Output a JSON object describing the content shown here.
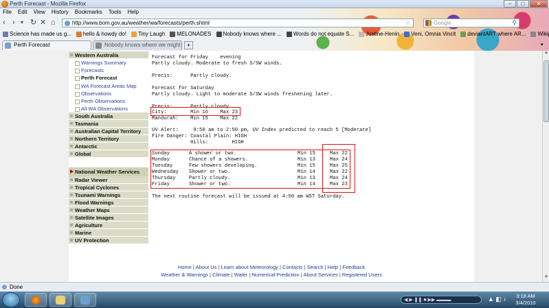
{
  "window": {
    "title": "Perth Forecast - Mozilla Firefox"
  },
  "menu": [
    "File",
    "Edit",
    "View",
    "History",
    "Bookmarks",
    "Tools",
    "Help"
  ],
  "nav": {
    "url": "http://www.bom.gov.au/weather/wa/forecasts/perth.shtml",
    "search_placeholder": "Google"
  },
  "bookmarks": [
    {
      "label": "Science has made us g...",
      "color": "#6b7fb0"
    },
    {
      "label": "hello & howdy do!",
      "color": "#e07b2a"
    },
    {
      "label": "Tiny Laugh",
      "color": "#e8a33a"
    },
    {
      "label": "MELONADES",
      "color": "#555555"
    },
    {
      "label": "Nobody knows where ...",
      "color": "#444444"
    },
    {
      "label": "Words do not equate S...",
      "color": "#444444"
    },
    {
      "label": "Justine-Henin",
      "color": "#bbbbbb"
    },
    {
      "label": "Veni, Omnia Vincit",
      "color": "#3b6fd6"
    },
    {
      "label": "deviantART where AR...",
      "color": "#6aa05a"
    },
    {
      "label": "Wikipedia",
      "color": "#888888"
    }
  ],
  "tabs": [
    {
      "label": "Perth Forecast",
      "active": true
    },
    {
      "label": "Nobody knows where we might en...",
      "active": false
    }
  ],
  "sidenav": {
    "region": "Western Australia",
    "region_items": [
      {
        "label": "Warnings Summary",
        "active": false
      },
      {
        "label": "Forecasts",
        "active": false
      },
      {
        "label": "Perth Forecast",
        "active": true
      },
      {
        "label": "WA Forecast Areas Map",
        "active": false
      },
      {
        "label": "Observations",
        "active": false
      },
      {
        "label": "Perth Observations",
        "active": false
      },
      {
        "label": "All WA Observations",
        "active": false
      }
    ],
    "states": [
      "South Australia",
      "Tasmania",
      "Australian Capital Territory",
      "Northern Territory",
      "Antarctic",
      "Global"
    ],
    "national": "National Weather Services",
    "national_items": [
      "Radar Viewer",
      "Tropical Cyclones",
      "Tsunami Warnings",
      "Flood Warnings",
      "Weather Maps",
      "Satellite Images",
      "Agriculture",
      "Marine",
      "UV Protection"
    ]
  },
  "forecast": {
    "friday_evening": "Forecast for Friday    evening",
    "friday_text": "Partly cloudy. Moderate to fresh S/SW winds.",
    "friday_precis": "Precis:      Partly cloudy.",
    "saturday_head": "Forecast for Saturday",
    "saturday_text": "Partly cloudy. Light to moderate S/SW winds freshening later.",
    "precis": "Precis:      Partly cloudy.",
    "city": "City:        Min 16    Max 23",
    "mandurah": "Mandurah:    Min 15    Max 22",
    "uv": "UV Alert:     9:50 am to 2:50 pm, UV Index predicted to reach 5 [Moderate]",
    "fire1": "Fire Danger: Coastal Plain: HIGH",
    "fire2": "             Hills:        HIGH",
    "week": [
      {
        "day": "Sunday",
        "desc": "A shower or two.",
        "min": "Min 15",
        "max": "Max 22"
      },
      {
        "day": "Monday",
        "desc": "Chance of a showers.",
        "min": "Min 13",
        "max": "Max 24"
      },
      {
        "day": "Tuesday",
        "desc": "Few showers developing.",
        "min": "Min 15",
        "max": "Max 25"
      },
      {
        "day": "Wednesday",
        "desc": "Shower or two.",
        "min": "Min 14",
        "max": "Max 22"
      },
      {
        "day": "Thursday",
        "desc": "Partly cloudy.",
        "min": "Min 13",
        "max": "Max 24"
      },
      {
        "day": "Friday",
        "desc": "Shower or two.",
        "min": "Min 14",
        "max": "Max 23"
      }
    ],
    "next_issue": "The next routine forecast will be issued at 4:50 am WST Saturday."
  },
  "footer": {
    "row1": [
      "Home",
      "About Us",
      "Learn about Meteorology",
      "Contacts",
      "Search",
      "Help",
      "Feedback"
    ],
    "row2": [
      "Weather & Warnings",
      "Climate",
      "Water",
      "Numerical Prediction",
      "About Services",
      "Registered Users"
    ]
  },
  "status": "Done",
  "clock": {
    "time": "3:18 AM",
    "date": "3/4/2010"
  },
  "accent": {
    "annotation": "#dd1111",
    "link": "#203a92"
  }
}
